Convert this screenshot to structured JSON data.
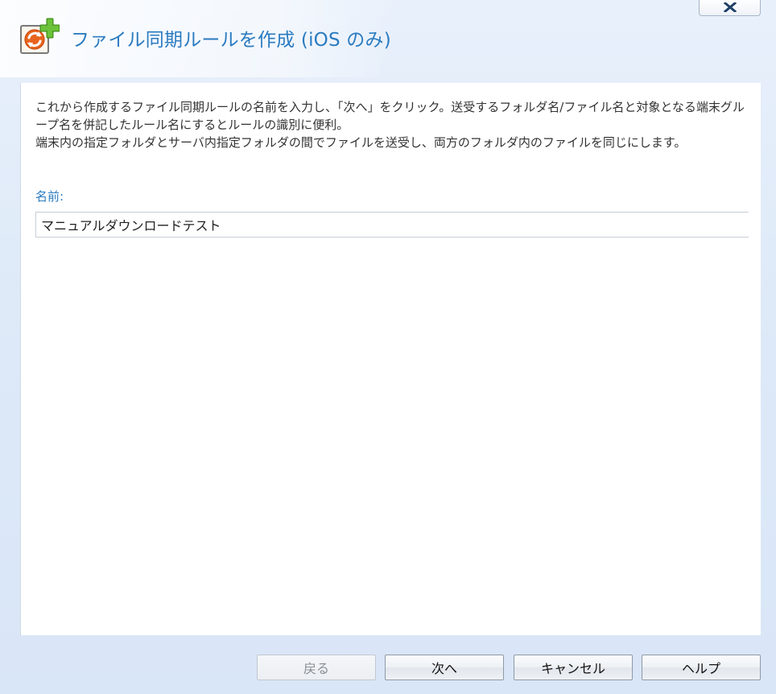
{
  "window": {
    "title": "ファイル同期ルールを作成 (iOS のみ)",
    "close_glyph": "x"
  },
  "icons": {
    "title_icon": "file-sync-add-icon",
    "close_icon": "close-icon"
  },
  "description": {
    "line1": "これから作成するファイル同期ルールの名前を入力し、「次へ」をクリック。送受するフォルダ名/ファイル名と対象となる端末グループ名を併記したルール名にするとルールの識別に便利。",
    "line2": "端末内の指定フォルダとサーバ内指定フォルダの間でファイルを送受し、両方のフォルダ内のファイルを同じにします。"
  },
  "form": {
    "name_label": "名前:",
    "name_value": "マニュアルダウンロードテスト"
  },
  "buttons": {
    "back": "戻る",
    "next": "次へ",
    "cancel": "キャンセル",
    "help": "ヘルプ"
  },
  "colors": {
    "accent": "#2b7bc0",
    "icon_orange": "#e8641e",
    "icon_green": "#5bb02c"
  }
}
